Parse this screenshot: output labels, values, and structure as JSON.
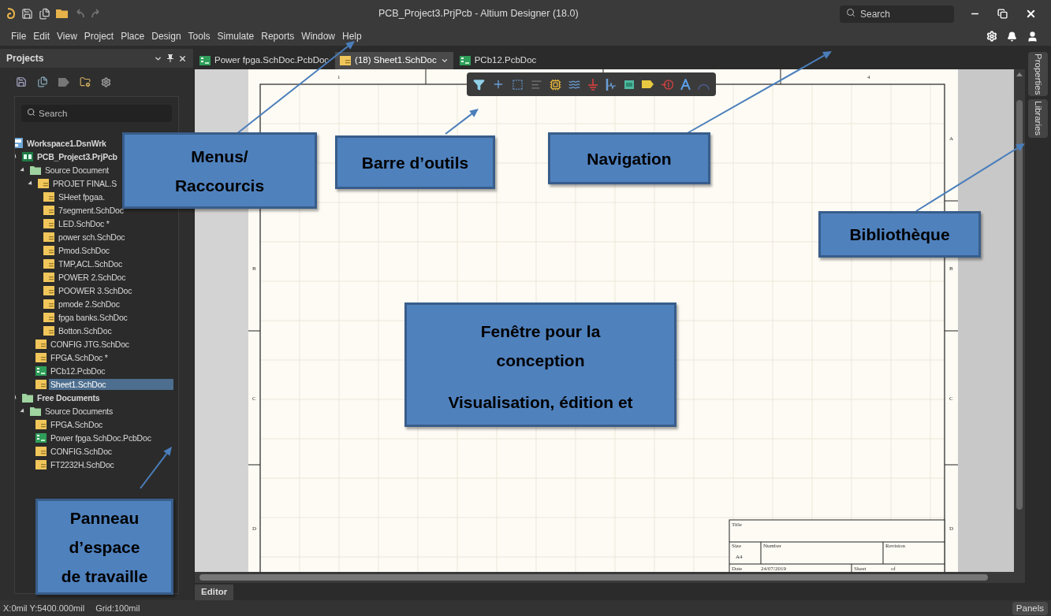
{
  "title_bar": {
    "title": "PCB_Project3.PrjPcb - Altium Designer (18.0)",
    "search": {
      "placeholder": "Search"
    }
  },
  "menu": [
    {
      "label": "File"
    },
    {
      "label": "Edit"
    },
    {
      "label": "View"
    },
    {
      "label": "Project"
    },
    {
      "label": "Place"
    },
    {
      "label": "Design"
    },
    {
      "label": "Tools"
    },
    {
      "label": "Simulate"
    },
    {
      "label": "Reports"
    },
    {
      "label": "Window"
    },
    {
      "label": "Help"
    }
  ],
  "projects_panel": {
    "title": "Projects",
    "search": {
      "placeholder": "Search"
    },
    "tree": [
      {
        "label": "Workspace1.DsnWrk",
        "kind": "workspace",
        "selected": false,
        "children": [
          {
            "label": "PCB_Project3.PrjPcb",
            "kind": "project",
            "expanded": true,
            "selected": false,
            "children": [
              {
                "label": "Source Document",
                "kind": "folder",
                "expanded": true,
                "selected": false,
                "children": [
                  {
                    "label": "PROJET FINAL.S",
                    "kind": "schdoc",
                    "expanded": true,
                    "selected": false,
                    "children": [
                      {
                        "label": "SHeet fpgaa.",
                        "kind": "schdoc",
                        "selected": false
                      },
                      {
                        "label": "7segment.SchDoc",
                        "kind": "schdoc",
                        "selected": false
                      },
                      {
                        "label": "LED.SchDoc *",
                        "kind": "schdoc",
                        "selected": false
                      },
                      {
                        "label": "power sch.SchDoc",
                        "kind": "schdoc",
                        "selected": false
                      },
                      {
                        "label": "Pmod.SchDoc",
                        "kind": "schdoc",
                        "selected": false
                      },
                      {
                        "label": "TMP,ACL.SchDoc",
                        "kind": "schdoc",
                        "selected": false
                      },
                      {
                        "label": "POWER 2.SchDoc",
                        "kind": "schdoc",
                        "selected": false
                      },
                      {
                        "label": "POOWER 3.SchDoc",
                        "kind": "schdoc",
                        "selected": false
                      },
                      {
                        "label": "pmode 2.SchDoc",
                        "kind": "schdoc",
                        "selected": false
                      },
                      {
                        "label": "fpga banks.SchDoc",
                        "kind": "schdoc",
                        "selected": false
                      },
                      {
                        "label": "Botton.SchDoc",
                        "kind": "schdoc",
                        "selected": false
                      }
                    ]
                  },
                  {
                    "label": "CONFIG JTG.SchDoc",
                    "kind": "schdoc",
                    "selected": false
                  },
                  {
                    "label": "FPGA.SchDoc *",
                    "kind": "schdoc",
                    "selected": false
                  },
                  {
                    "label": "PCb12.PcbDoc",
                    "kind": "pcbdoc",
                    "selected": false
                  },
                  {
                    "label": "Sheet1.SchDoc",
                    "kind": "schdoc",
                    "selected": true
                  }
                ]
              }
            ]
          },
          {
            "label": "Free Documents",
            "kind": "group",
            "expanded": true,
            "selected": false,
            "children": [
              {
                "label": "Source Documents",
                "kind": "folder",
                "expanded": true,
                "selected": false,
                "children": [
                  {
                    "label": "FPGA.SchDoc",
                    "kind": "schdoc",
                    "selected": false
                  },
                  {
                    "label": "Power fpga.SchDoc.PcbDoc",
                    "kind": "pcbdoc",
                    "selected": false
                  },
                  {
                    "label": "CONFIG.SchDoc",
                    "kind": "schdoc",
                    "selected": false
                  },
                  {
                    "label": "FT2232H.SchDoc",
                    "kind": "schdoc",
                    "selected": false
                  }
                ]
              }
            ]
          }
        ]
      }
    ]
  },
  "document_tabs": [
    {
      "label": "Power fpga.SchDoc.PcbDoc",
      "kind": "pcbdoc",
      "selected": false
    },
    {
      "label": "(18) Sheet1.SchDoc",
      "kind": "schdoc",
      "selected": true
    },
    {
      "label": "PCb12.PcbDoc",
      "kind": "pcbdoc",
      "selected": false
    }
  ],
  "sheet": {
    "column_labels": [
      "1",
      "4"
    ],
    "row_labels_left": [
      "B",
      "C",
      "D"
    ],
    "row_labels_right": [
      "A",
      "B",
      "C",
      "D"
    ],
    "title_block": {
      "title": "Title",
      "size": "Size",
      "size_value": "A4",
      "number": "Number",
      "revision": "Revision",
      "date": "Date",
      "date_value": "24/07/2019",
      "sheet": "Sheet",
      "of": "of"
    }
  },
  "side_tabs": [
    "Properties",
    "Libraries"
  ],
  "editor_tab": "Editor",
  "status_bar": {
    "coordinates": "X:0mil Y:5400.000mil",
    "grid": "Grid:100mil",
    "panels_button": "Panels"
  },
  "annotations": [
    {
      "lines": [
        "Menus/",
        "Raccourcis"
      ]
    },
    {
      "lines": [
        "Barre d’outils"
      ]
    },
    {
      "lines": [
        "Navigation"
      ]
    },
    {
      "lines": [
        "Bibliothèque"
      ]
    },
    {
      "lines": [
        "Fenêtre pour la",
        "conception"
      ],
      "note": "Visualisation, édition et"
    },
    {
      "lines": [
        "Panneau",
        "d’espace",
        "de travaille"
      ]
    }
  ]
}
